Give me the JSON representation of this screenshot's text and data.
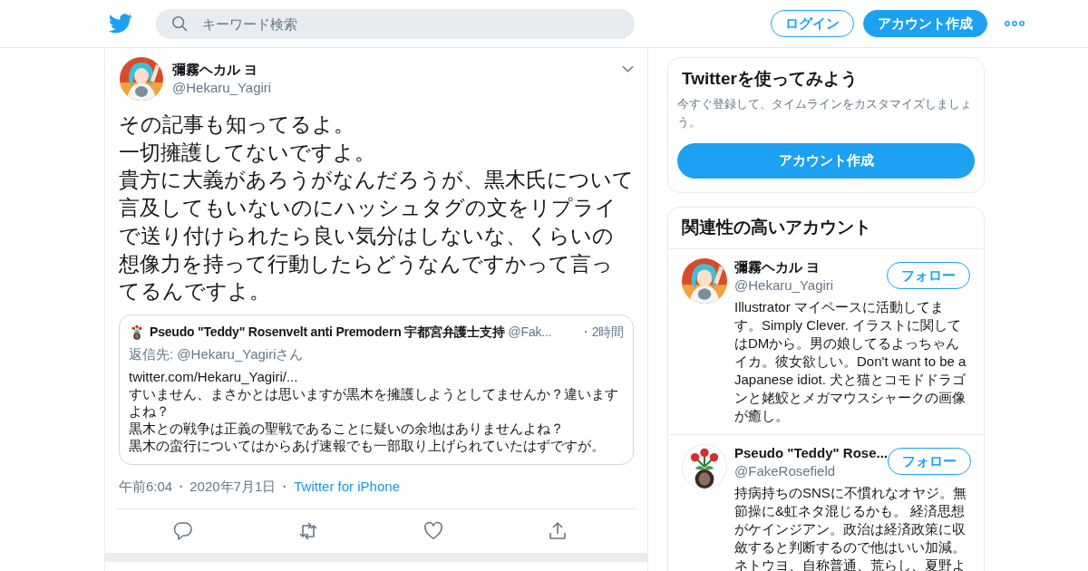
{
  "header": {
    "search": {
      "placeholder": "キーワード検索"
    },
    "buttons": [
      {
        "label": "ログイン",
        "kind": "outline"
      },
      {
        "label": "アカウント作成",
        "kind": "filled"
      }
    ]
  },
  "tweet": {
    "author": {
      "name": "彌霧ヘカル ヨ",
      "handle": "@Hekaru_Yagiri"
    },
    "paragraphs": [
      "その記事も知ってるよ。",
      "一切擁護してないですよ。",
      "貴方に大義があろうがなんだろうが、黒木氏について",
      "言及してもいないのにハッシュタグの文をリプライ",
      "で送り付けられたら良い気分はしないな、くらいの",
      "想像力を持って行動したらどうなんですかって言っ",
      "てるんですよ。"
    ],
    "quote": {
      "name": "Pseudo \"Teddy\" Rosenvelt anti Premodern 宇都宮弁護士支持",
      "handle": "@Fak...",
      "time": "・2時間",
      "reply_to": "返信先: @Hekaru_Yagiriさん",
      "lines": [
        "twitter.com/Hekaru_Yagiri/...",
        "すいません、まさかとは思いますが黒木を擁護しようとしてませんか？違いますよね？",
        "黒木との戦争は正義の聖戦であることに疑いの余地はありませんよね？",
        "黒木の蛮行についてはからあげ速報でも一部取り上げられていたはずですが。"
      ]
    },
    "meta": [
      {
        "text": "午前6:04",
        "kind": "text"
      },
      {
        "text": "・",
        "kind": "text"
      },
      {
        "text": "2020年7月1日",
        "kind": "text"
      },
      {
        "text": "・",
        "kind": "text"
      },
      {
        "text": "Twitter for iPhone",
        "kind": "link"
      }
    ],
    "actions": [
      {
        "kind": "reply"
      },
      {
        "kind": "retweet"
      },
      {
        "kind": "like"
      },
      {
        "kind": "share"
      }
    ]
  },
  "sidebar": {
    "signup": {
      "title": "Twitterを使ってみよう",
      "description": "今すぐ登録して、タイムラインをカスタマイズしましょう。",
      "button": "アカウント作成"
    },
    "related": {
      "title": "関連性の高いアカウント",
      "accounts": [
        {
          "name": "彌霧ヘカル ヨ",
          "handle": "@Hekaru_Yagiri",
          "follow": "フォロー",
          "bio": "Illustrator マイペースに活動してます。Simply Clever. イラストに関してはDMから。男の娘してるよっちゃんイカ。彼女欲しい。Don't want to be a Japanese idiot. 犬と猫とコモドドラゴンと姥鮫とメガマウスシャークの画像が癒し。"
        },
        {
          "name": "Pseudo \"Teddy\" Rose...",
          "handle": "@FakeRosefield",
          "follow": "フォロー",
          "bio": "持病持ちのSNSに不慣れなオヤジ。無節操に&虹ネタ混じるかも。 経済思想がケインジアン。政治は経済政策に収斂すると判断するので他はいい加減。ネトウヨ、自称普通、荒らし、夏野よ"
        }
      ]
    }
  }
}
